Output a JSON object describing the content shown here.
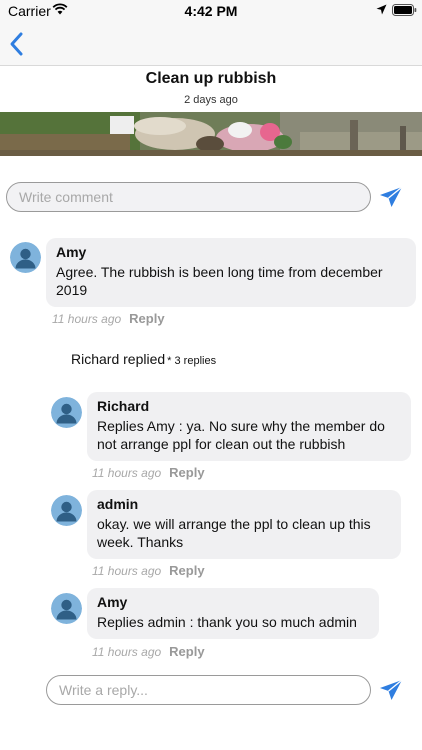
{
  "status_bar": {
    "carrier": "Carrier",
    "time": "4:42 PM"
  },
  "post": {
    "title": "Clean up rubbish",
    "time_ago": "2 days ago"
  },
  "comment_box": {
    "placeholder": "Write comment"
  },
  "comment": {
    "author": "Amy",
    "text": "Agree. The rubbish is been long time from december 2019",
    "time": "11 hours ago",
    "reply_label": "Reply"
  },
  "replies_summary": {
    "text": "Richard replied",
    "count": "* 3 replies"
  },
  "replies": [
    {
      "author": "Richard",
      "text": "Replies Amy : ya. No sure why the member do not arrange ppl for clean out the rubbish",
      "time": "11 hours ago",
      "reply_label": "Reply"
    },
    {
      "author": "admin",
      "text": "okay. we will arrange the ppl to clean up this week. Thanks",
      "time": "11 hours ago",
      "reply_label": "Reply"
    },
    {
      "author": "Amy",
      "text": "Replies admin : thank you so much admin",
      "time": "11 hours ago",
      "reply_label": "Reply"
    }
  ],
  "reply_box": {
    "placeholder": "Write a reply..."
  },
  "colors": {
    "accent": "#2f7ee0",
    "avatar": "#7fb3dc",
    "bubble": "#f0f0f2"
  }
}
